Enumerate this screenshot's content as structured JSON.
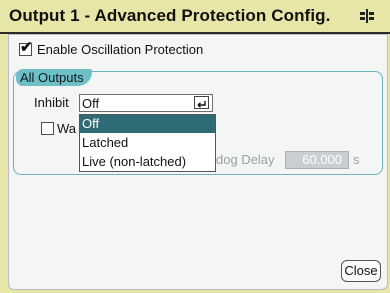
{
  "title": "Output 1 - Advanced Protection Config.",
  "title_icon": "output-channel-icon",
  "oscillation": {
    "checked": true,
    "label": "Enable Oscillation Protection"
  },
  "group": {
    "label": "All Outputs",
    "inhibit": {
      "label": "Inhibit",
      "value": "Off",
      "options": [
        "Off",
        "Latched",
        "Live (non-latched)"
      ],
      "selected_index": 0
    },
    "watchdog": {
      "checked": false,
      "label_visible_left": "Wa",
      "delay_label_visible": "dog Delay",
      "delay_value": "60.000",
      "delay_unit": "s"
    }
  },
  "close_label": "Close",
  "colors": {
    "window_bg": "#e7e5a8",
    "panel_bg": "#f4f6f6",
    "group_tab": "#6fbfc6",
    "selected_option": "#2f6b74",
    "disabled_field": "#c9cfd1"
  }
}
